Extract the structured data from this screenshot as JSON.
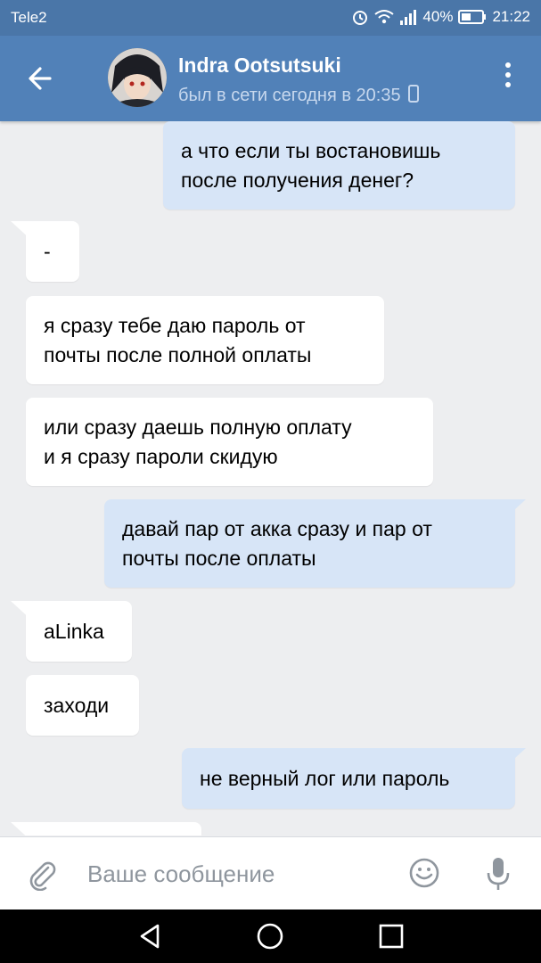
{
  "status_bar": {
    "carrier": "Tele2",
    "battery": "40%",
    "time": "21:22"
  },
  "header": {
    "name": "Indra Ootsutsuki",
    "status": "был в сети сегодня в 20:35"
  },
  "messages": [
    {
      "direction": "out",
      "lines": [
        "а что если ты востановишь",
        "после получения денег?"
      ]
    },
    {
      "direction": "in",
      "lines": [
        "-"
      ]
    },
    {
      "direction": "in",
      "lines": [
        "я сразу тебе даю пароль от",
        "почты после полной оплаты"
      ]
    },
    {
      "direction": "in",
      "lines": [
        "или сразу даешь полную оплату",
        "и я сразу пароли скидую"
      ]
    },
    {
      "direction": "out",
      "lines": [
        "давай пар от акка сразу и пар от",
        "почты после оплаты"
      ]
    },
    {
      "direction": "in",
      "lines": [
        "aLinka"
      ]
    },
    {
      "direction": "in",
      "lines": [
        "заходи"
      ]
    },
    {
      "direction": "out",
      "lines": [
        "не верный лог или пароль"
      ]
    }
  ],
  "composer": {
    "placeholder": "Ваше сообщение"
  },
  "icons": {
    "back": "arrow-left-icon",
    "menu": "more-vertical-icon",
    "attach": "paperclip-icon",
    "emoji": "smiley-icon",
    "mic": "microphone-icon",
    "nav": [
      "nav-back-icon",
      "nav-home-icon",
      "nav-recents-icon"
    ]
  },
  "colors": {
    "header": "#5181b8",
    "status_bar": "#4a76a8",
    "outgoing_bubble": "#d7e5f7",
    "incoming_bubble": "#ffffff",
    "chat_background": "#edeef0"
  }
}
